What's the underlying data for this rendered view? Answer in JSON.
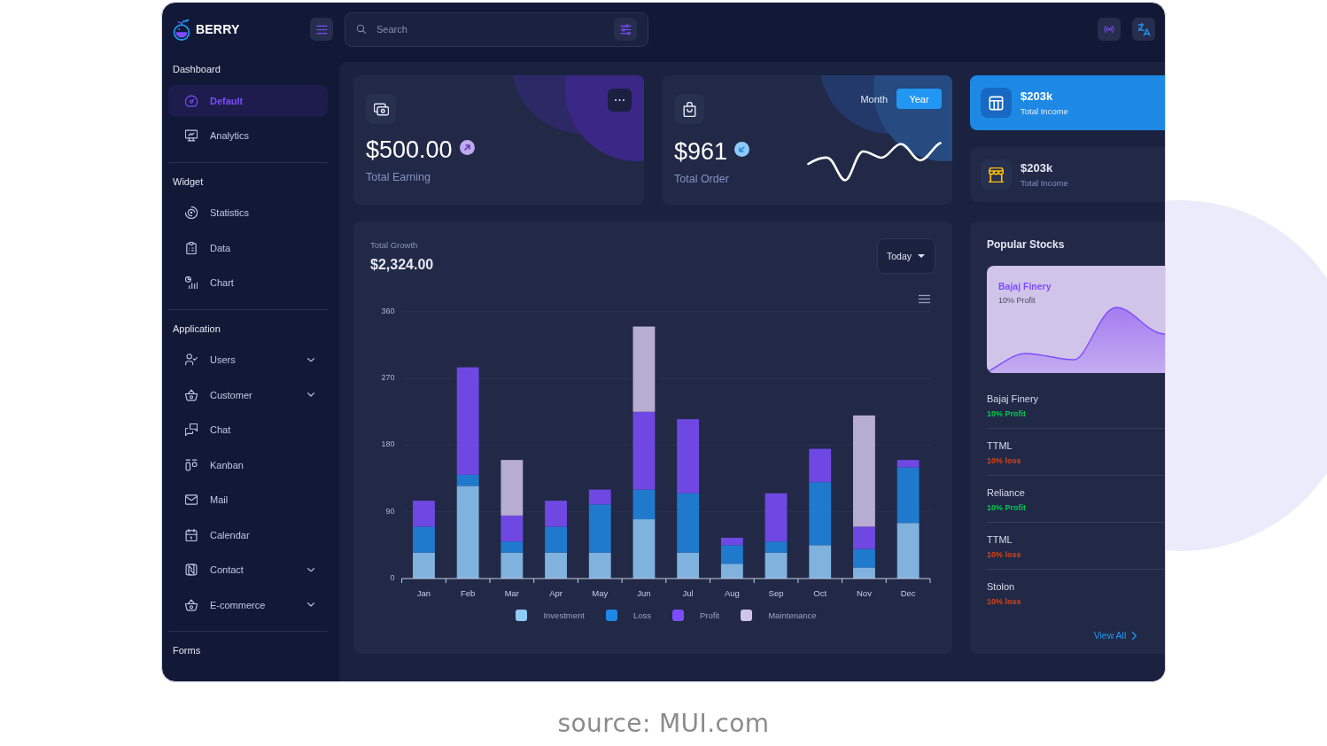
{
  "topbar": {
    "brand": "BERRY",
    "search": {
      "placeholder": "Search"
    }
  },
  "sidebar": {
    "sections": [
      {
        "title": "Dashboard",
        "items": [
          {
            "label": "Default",
            "selected": true,
            "kind": "link"
          },
          {
            "label": "Analytics",
            "selected": false,
            "kind": "link"
          }
        ]
      },
      {
        "title": "Widget",
        "items": [
          {
            "label": "Statistics",
            "selected": false,
            "kind": "link"
          },
          {
            "label": "Data",
            "selected": false,
            "kind": "link"
          },
          {
            "label": "Chart",
            "selected": false,
            "kind": "link"
          }
        ]
      },
      {
        "title": "Application",
        "items": [
          {
            "label": "Users",
            "selected": false,
            "kind": "group"
          },
          {
            "label": "Customer",
            "selected": false,
            "kind": "group"
          },
          {
            "label": "Chat",
            "selected": false,
            "kind": "link"
          },
          {
            "label": "Kanban",
            "selected": false,
            "kind": "link"
          },
          {
            "label": "Mail",
            "selected": false,
            "kind": "link"
          },
          {
            "label": "Calendar",
            "selected": false,
            "kind": "link"
          },
          {
            "label": "Contact",
            "selected": false,
            "kind": "group"
          },
          {
            "label": "E-commerce",
            "selected": false,
            "kind": "group"
          }
        ]
      },
      {
        "title": "Forms"
      }
    ]
  },
  "earning_card": {
    "amount": "$500.00",
    "label": "Total Earning",
    "rising": true
  },
  "order_card": {
    "periods": [
      {
        "label": "Month",
        "selected": false
      },
      {
        "label": "Year",
        "selected": true
      }
    ],
    "amount": "$961",
    "label": "Total Order",
    "rising": false
  },
  "income_cards": [
    {
      "kind": "highlight",
      "amount": "$203k",
      "label": "Total Income"
    },
    {
      "kind": "plain",
      "amount": "$203k",
      "label": "Total Income"
    }
  ],
  "growth_card": {
    "title": "Total Growth",
    "amount": "$2,324.00",
    "period": "Today",
    "chart_data": {
      "type": "bar",
      "stacked": true,
      "grid": true,
      "legend": "bottom",
      "categories": [
        "Jan",
        "Feb",
        "Mar",
        "Apr",
        "May",
        "Jun",
        "Jul",
        "Aug",
        "Sep",
        "Oct",
        "Nov",
        "Dec"
      ],
      "series": [
        {
          "name": "Investment",
          "color": "#90caf9",
          "values": [
            35,
            125,
            35,
            35,
            35,
            80,
            35,
            20,
            35,
            45,
            15,
            75
          ]
        },
        {
          "name": "Loss",
          "color": "#1e88e5",
          "values": [
            35,
            15,
            15,
            35,
            65,
            40,
            80,
            25,
            15,
            85,
            25,
            75
          ]
        },
        {
          "name": "Profit",
          "color": "#7c4dff",
          "values": [
            35,
            145,
            35,
            35,
            20,
            105,
            100,
            10,
            65,
            45,
            30,
            10
          ]
        },
        {
          "name": "Maintenance",
          "color": "#d1c4e9",
          "values": [
            0,
            0,
            75,
            0,
            0,
            115,
            0,
            0,
            0,
            0,
            150,
            0
          ]
        }
      ],
      "ylim": [
        0,
        360
      ],
      "yticks": [
        0,
        90,
        180,
        270,
        360
      ]
    }
  },
  "stocks_card": {
    "title": "Popular Stocks",
    "featured": {
      "name": "Bajaj Finery",
      "change": "10% Profit"
    },
    "items": [
      {
        "name": "Bajaj Finery",
        "change": "10% Profit",
        "color": "#00c853"
      },
      {
        "name": "TTML",
        "change": "10% loss",
        "color": "#d84315"
      },
      {
        "name": "Reliance",
        "change": "10% Profit",
        "color": "#00c853"
      },
      {
        "name": "TTML",
        "change": "10% loss",
        "color": "#d84315"
      },
      {
        "name": "Stolon",
        "change": "10% loss",
        "color": "#d84315"
      }
    ],
    "link": "View All"
  },
  "caption": "source: MUI.com"
}
